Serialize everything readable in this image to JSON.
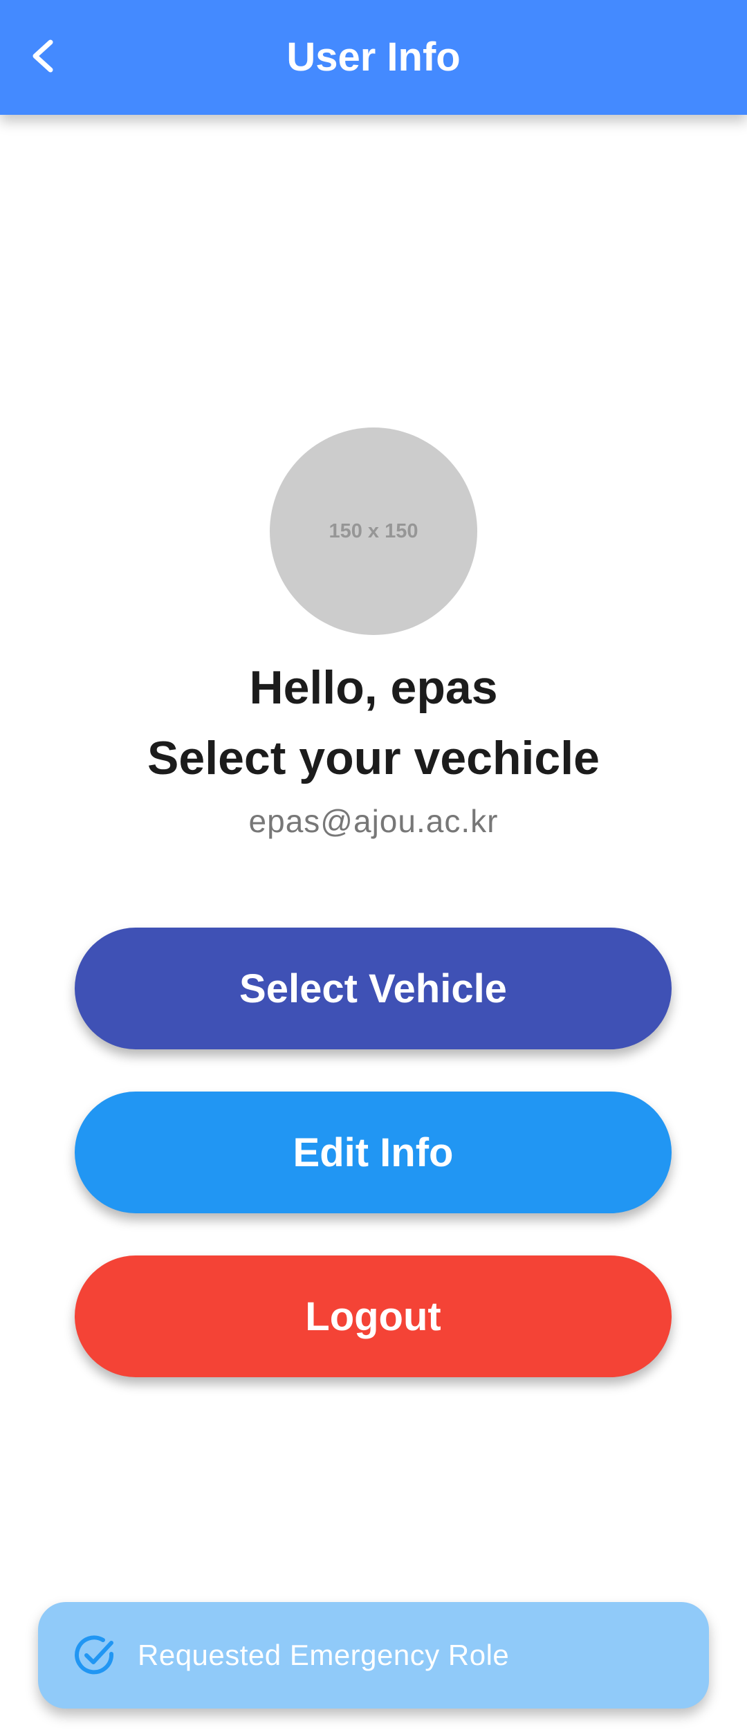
{
  "app_bar": {
    "title": "User Info",
    "back_icon": "chevron-left-icon",
    "background": "#448aff"
  },
  "profile": {
    "avatar_placeholder": "150 x 150",
    "greeting_line1": "Hello, epas",
    "greeting_line2": "Select your vechicle",
    "email": "epas@ajou.ac.kr"
  },
  "buttons": {
    "select_vehicle": {
      "label": "Select Vehicle",
      "color": "#3f51b5"
    },
    "edit_info": {
      "label": "Edit Info",
      "color": "#2196f3"
    },
    "logout": {
      "label": "Logout",
      "color": "#f44336"
    }
  },
  "snackbar": {
    "icon": "check-circle-icon",
    "message": "Requested Emergency Role",
    "background": "#90caf9"
  }
}
